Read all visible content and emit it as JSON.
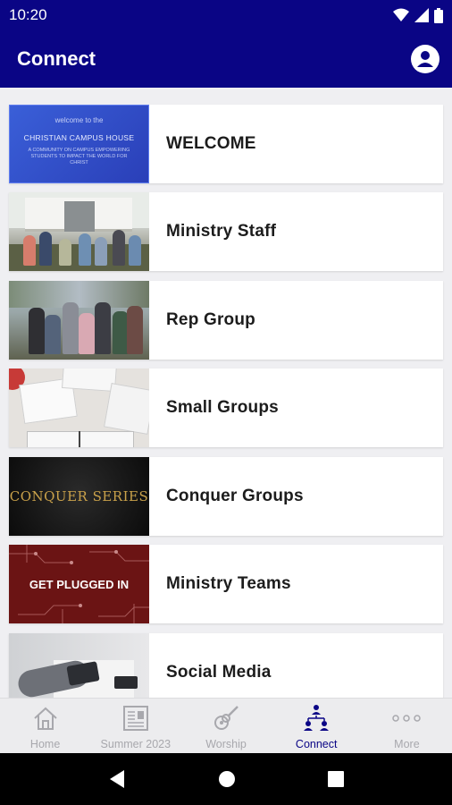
{
  "status_bar": {
    "time": "10:20",
    "icons": [
      "wifi-icon",
      "signal-icon",
      "battery-icon"
    ]
  },
  "app_bar": {
    "title": "Connect",
    "profile_icon": "account-circle-icon"
  },
  "colors": {
    "primary": "#0a0585",
    "background": "#efeff2",
    "inactive": "#a8a8ad"
  },
  "cards": [
    {
      "label": "WELCOME",
      "thumb_text": [
        "welcome to the",
        "CHRISTIAN CAMPUS HOUSE",
        "A COMMUNITY ON CAMPUS EMPOWERING STUDENTS TO IMPACT THE WORLD FOR CHRIST"
      ]
    },
    {
      "label": "Ministry Staff"
    },
    {
      "label": "Rep Group"
    },
    {
      "label": "Small Groups"
    },
    {
      "label": "Conquer Groups",
      "thumb_text": "CONQUER SERIES"
    },
    {
      "label": "Ministry Teams",
      "thumb_text": "GET PLUGGED IN"
    },
    {
      "label": "Social Media"
    }
  ],
  "bottom_nav": [
    {
      "label": "Home",
      "icon": "home-icon",
      "active": false
    },
    {
      "label": "Summer 2023",
      "icon": "newspaper-icon",
      "active": false
    },
    {
      "label": "Worship",
      "icon": "guitar-icon",
      "active": false
    },
    {
      "label": "Connect",
      "icon": "people-connect-icon",
      "active": true
    },
    {
      "label": "More",
      "icon": "more-dots-icon",
      "active": false
    }
  ],
  "system_nav": [
    "back-icon",
    "home-circle-icon",
    "recents-icon"
  ]
}
